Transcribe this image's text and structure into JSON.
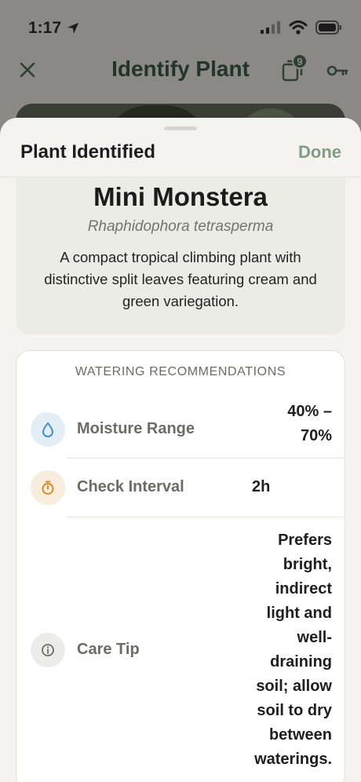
{
  "status": {
    "time": "1:17"
  },
  "nav": {
    "title": "Identify Plant",
    "badge_count": "9"
  },
  "sheet": {
    "title": "Plant Identified",
    "done_label": "Done"
  },
  "plant": {
    "common_name": "Mini Monstera",
    "scientific_name": "Rhaphidophora tetrasperma",
    "description": "A compact tropical climbing plant with distinctive split leaves featuring cream and green variegation."
  },
  "watering": {
    "heading": "WATERING RECOMMENDATIONS",
    "rows": [
      {
        "icon": "droplet-icon",
        "label": "Moisture Range",
        "value": "40% – 70%"
      },
      {
        "icon": "timer-icon",
        "label": "Check Interval",
        "value": "2h"
      },
      {
        "icon": "info-icon",
        "label": "Care Tip",
        "value": "Prefers bright, indirect light and well-draining soil; allow soil to dry between waterings."
      }
    ]
  },
  "colors": {
    "accent_green": "#7f9d84",
    "title_green": "#23352a",
    "droplet_bg": "#e3eef6",
    "timer_bg": "#f8ecdc",
    "info_bg": "#ececea"
  }
}
